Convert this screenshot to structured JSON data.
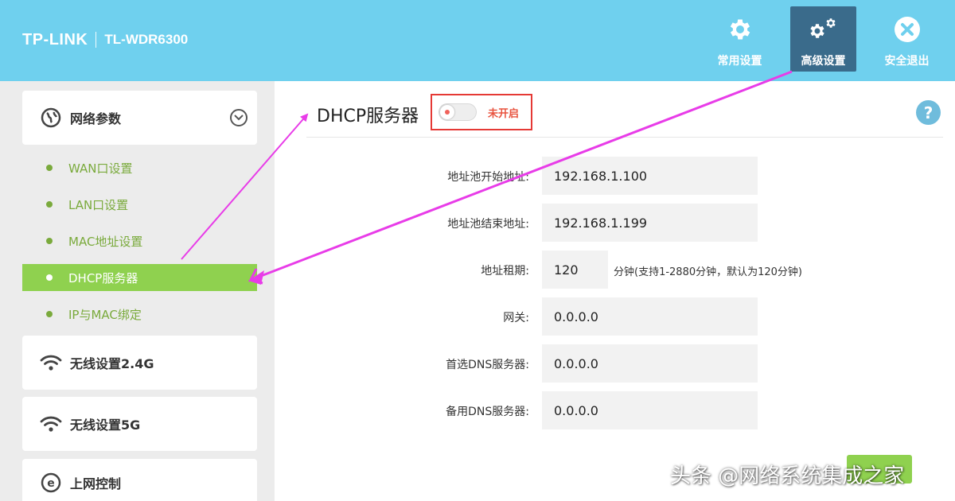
{
  "header": {
    "brand": "TP-LINK",
    "model": "TL-WDR6300",
    "buttons": [
      {
        "label": "常用设置",
        "icon": "gear-icon"
      },
      {
        "label": "高级设置",
        "icon": "gears-icon"
      },
      {
        "label": "安全退出",
        "icon": "close-circle-icon"
      }
    ]
  },
  "sidebar": {
    "network": {
      "label": "网络参数",
      "icon": "globe-icon"
    },
    "sub_items": [
      "WAN口设置",
      "LAN口设置",
      "MAC地址设置",
      "DHCP服务器",
      "IP与MAC绑定"
    ],
    "active_index": 3,
    "wifi24": {
      "label": "无线设置2.4G",
      "icon": "wifi-icon"
    },
    "wifi5": {
      "label": "无线设置5G",
      "icon": "wifi-icon"
    },
    "access": {
      "label": "上网控制",
      "icon": "internet-e-icon"
    }
  },
  "main": {
    "title": "DHCP服务器",
    "toggle_status": "未开启",
    "fields": {
      "pool_start": {
        "label": "地址池开始地址:",
        "value": "192.168.1.100"
      },
      "pool_end": {
        "label": "地址池结束地址:",
        "value": "192.168.1.199"
      },
      "lease": {
        "label": "地址租期:",
        "value": "120",
        "hint": "分钟(支持1-2880分钟，默认为120分钟)"
      },
      "gateway": {
        "label": "网关:",
        "value": "0.0.0.0"
      },
      "dns1": {
        "label": "首选DNS服务器:",
        "value": "0.0.0.0"
      },
      "dns2": {
        "label": "备用DNS服务器:",
        "value": "0.0.0.0"
      }
    }
  },
  "colors": {
    "header_bg": "#6fd0ee",
    "active_top_btn": "#3a6b8b",
    "accent_green": "#8fd14f",
    "sub_item_green": "#7aaa3c",
    "status_red": "#e53935",
    "annotation_magenta": "#e83ce8"
  },
  "watermark": "头条 @网络系统集成之家"
}
